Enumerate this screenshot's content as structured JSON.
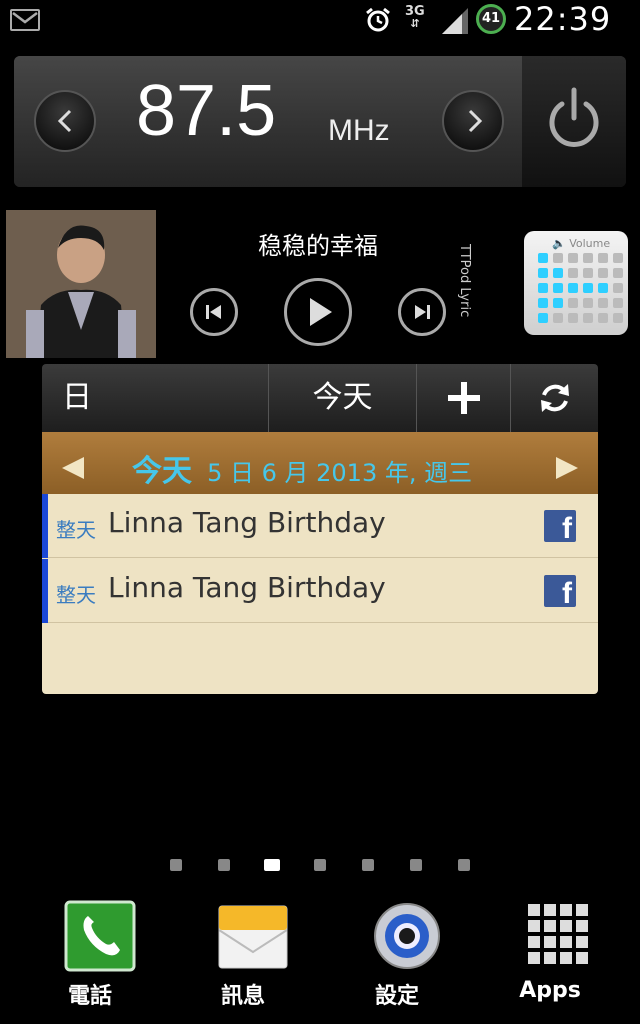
{
  "status_bar": {
    "network": "3G",
    "battery": "41",
    "time": "22:39"
  },
  "radio": {
    "frequency": "87.5",
    "unit": "MHz"
  },
  "music": {
    "song_title": "稳稳的幸福",
    "lyric_label": "TTPod Lyric"
  },
  "volume_widget": {
    "label": "Volume"
  },
  "calendar": {
    "view_label": "日",
    "today_button": "今天",
    "today_label": "今天",
    "date": "5 日 6 月 2013 年, 週三",
    "events": [
      {
        "allday": "整天",
        "title": "Linna Tang Birthday"
      },
      {
        "allday": "整天",
        "title": "Linna Tang Birthday"
      }
    ]
  },
  "home_pages": {
    "count": 7,
    "current": 3
  },
  "dock": {
    "items": [
      {
        "label": "電話",
        "icon": "phone-icon"
      },
      {
        "label": "訊息",
        "icon": "message-icon"
      },
      {
        "label": "設定",
        "icon": "settings-icon"
      },
      {
        "label": "Apps",
        "icon": "apps-icon"
      }
    ]
  },
  "colors": {
    "calendar_accent": "#46c7ea",
    "event_bar": "#1a47d6",
    "calendar_body": "#eee3c4"
  }
}
